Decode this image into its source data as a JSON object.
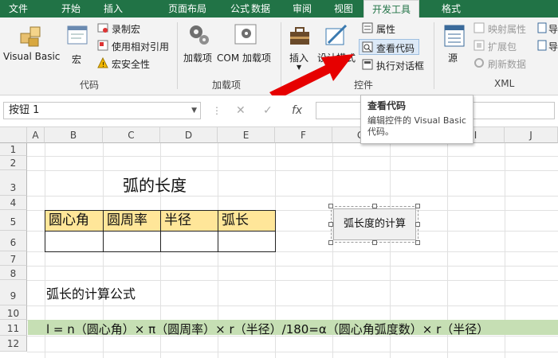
{
  "ribbon_tabs": {
    "file": "文件",
    "home": "开始",
    "insert": "插入",
    "page_layout": "页面布局",
    "formulas": "公式",
    "data": "数据",
    "review": "审阅",
    "view": "视图",
    "developer": "开发工具",
    "format": "格式"
  },
  "code_group": {
    "visual_basic": "Visual Basic",
    "macros": "宏",
    "record_macro": "录制宏",
    "use_relative": "使用相对引用",
    "macro_security": "宏安全性",
    "label": "代码"
  },
  "addins_group": {
    "addins": "加载项",
    "com_addins": "COM 加载项",
    "label": "加载项"
  },
  "controls_group": {
    "insert": "插入",
    "design_mode": "设计模式",
    "properties": "属性",
    "view_code": "查看代码",
    "run_dialog": "执行对话框",
    "label": "控件"
  },
  "xml_group": {
    "source": "源",
    "map_properties": "映射属性",
    "import": "导",
    "expansion_packs": "扩展包",
    "export": "导",
    "refresh_data": "刷新数据",
    "label": "XML"
  },
  "formula_bar": {
    "name_box": "按钮 1",
    "cancel": "✕",
    "enter": "✓",
    "fx": "fx",
    "content": ""
  },
  "tooltip": {
    "title": "查看代码",
    "description": "编辑控件的 Visual Basic 代码。"
  },
  "columns": [
    "A",
    "B",
    "C",
    "D",
    "E",
    "F",
    "G",
    "H",
    "I",
    "J"
  ],
  "rows": [
    "1",
    "2",
    "3",
    "4",
    "5",
    "6",
    "7",
    "8",
    "9",
    "10",
    "11",
    "12"
  ],
  "sheet": {
    "title": "弧的长度",
    "table_headers": [
      "圆心角",
      "圆周率",
      "半径",
      "弧长"
    ],
    "button_label": "弧长度的计算",
    "formula_title": "弧长的计算公式",
    "formula": "l = n（圆心角）× π（圆周率）× r（半径）/180=α（圆心角弧度数）× r（半径）"
  },
  "colors": {
    "accent": "#217346",
    "header_fill": "#ffe699",
    "formula_fill": "#c6dfb4",
    "arrow": "#e60000"
  }
}
